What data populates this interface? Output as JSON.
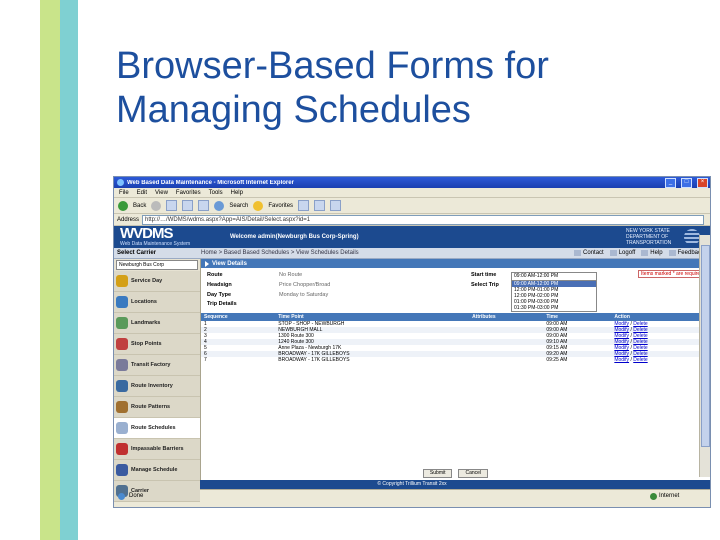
{
  "slide": {
    "title": "Browser-Based Forms for\nManaging Schedules"
  },
  "browser": {
    "title": "Web Based Data Maintenance - Microsoft Internet Explorer",
    "menus": [
      "File",
      "Edit",
      "View",
      "Favorites",
      "Tools",
      "Help"
    ],
    "toolbar": {
      "back": "Back",
      "search": "Search",
      "favorites": "Favorites"
    },
    "address_label": "Address",
    "address_value": "http://…/WDMS/wdms.aspx?App=AIS/Detail/Select.aspx?id=1",
    "status_text": "Done",
    "zone_text": "Internet"
  },
  "app": {
    "logo": "WVDMS",
    "logo_sub": "Web Data Maintenance System",
    "welcome": "Welcome admin(Newburgh Bus Corp-Spring)",
    "state": [
      "NEW YORK STATE",
      "DEPARTMENT OF",
      "TRANSPORTATION"
    ],
    "select_carrier_label": "Select Carrier",
    "carrier_value": "Newburgh Bus Corp",
    "breadcrumb": "Home > Based Based Schedules > View Schedules Details",
    "tools": [
      "Contact",
      "Logoff",
      "Help",
      "Feedback"
    ],
    "nav": [
      "Service Day",
      "Locations",
      "Landmarks",
      "Stop Points",
      "Transit Factory",
      "Route Inventory",
      "Route Patterns",
      "Route Schedules",
      "Impassable Barriers",
      "Manage Schedule",
      "Carrier"
    ],
    "active_nav_index": 7,
    "section_title": "View Details",
    "required_note": "Items marked * are required",
    "details": [
      {
        "k": "Route",
        "v": "No Route"
      },
      {
        "k": "Headsign",
        "v": "Price Chopper/Broad"
      },
      {
        "k": "Day Type",
        "v": "Monday to Saturday"
      },
      {
        "k": "Trip Details",
        "v": ""
      }
    ],
    "start_time_label": "Start time",
    "select_trip_label": "Select Trip",
    "start_time_value": "09:00 AM-12:00 PM",
    "trip_options": [
      "09:00 AM-12:00 PM",
      "12:00 PM-01:00 PM",
      "12:00 PM-02:00 PM",
      "01:00 PM-03:00 PM",
      "01:30 PM-03:00 PM"
    ],
    "selected_trip_index": 0,
    "table": {
      "headers": [
        "Sequence",
        "Time Point",
        "Attributes",
        "Time",
        "Action"
      ],
      "rows": [
        [
          "1",
          "STOP - SHOP - NEWBURGH",
          "",
          "09:00 AM",
          "Modify",
          "Delete"
        ],
        [
          "2",
          "NEWBURGH MALL",
          "",
          "09:00 AM",
          "Modify",
          "Delete"
        ],
        [
          "3",
          "1300 Route 300",
          "",
          "09:00 AM",
          "Modify",
          "Delete"
        ],
        [
          "4",
          "1240 Route 300",
          "",
          "09:10 AM",
          "Modify",
          "Delete"
        ],
        [
          "5",
          "Anne Plaza - Newburgh 17K",
          "",
          "09:15 AM",
          "Modify",
          "Delete"
        ],
        [
          "6",
          "BROADWAY - 17K GILLEBOYS",
          "",
          "09:20 AM",
          "Modify",
          "Delete"
        ],
        [
          "7",
          "BROADWAY - 17K GILLEBOYS",
          "",
          "09:25 AM",
          "Modify",
          "Delete"
        ]
      ]
    },
    "buttons": {
      "submit": "Submit",
      "cancel": "Cancel"
    },
    "footer": "© Copyright Trillium Transit 2xx"
  },
  "colors": {
    "accent_green": "#c9e48a",
    "accent_teal": "#7fd0d2",
    "title_blue": "#1d4f9e",
    "app_blue": "#1c4a8f",
    "header_blue": "#4477b8"
  }
}
